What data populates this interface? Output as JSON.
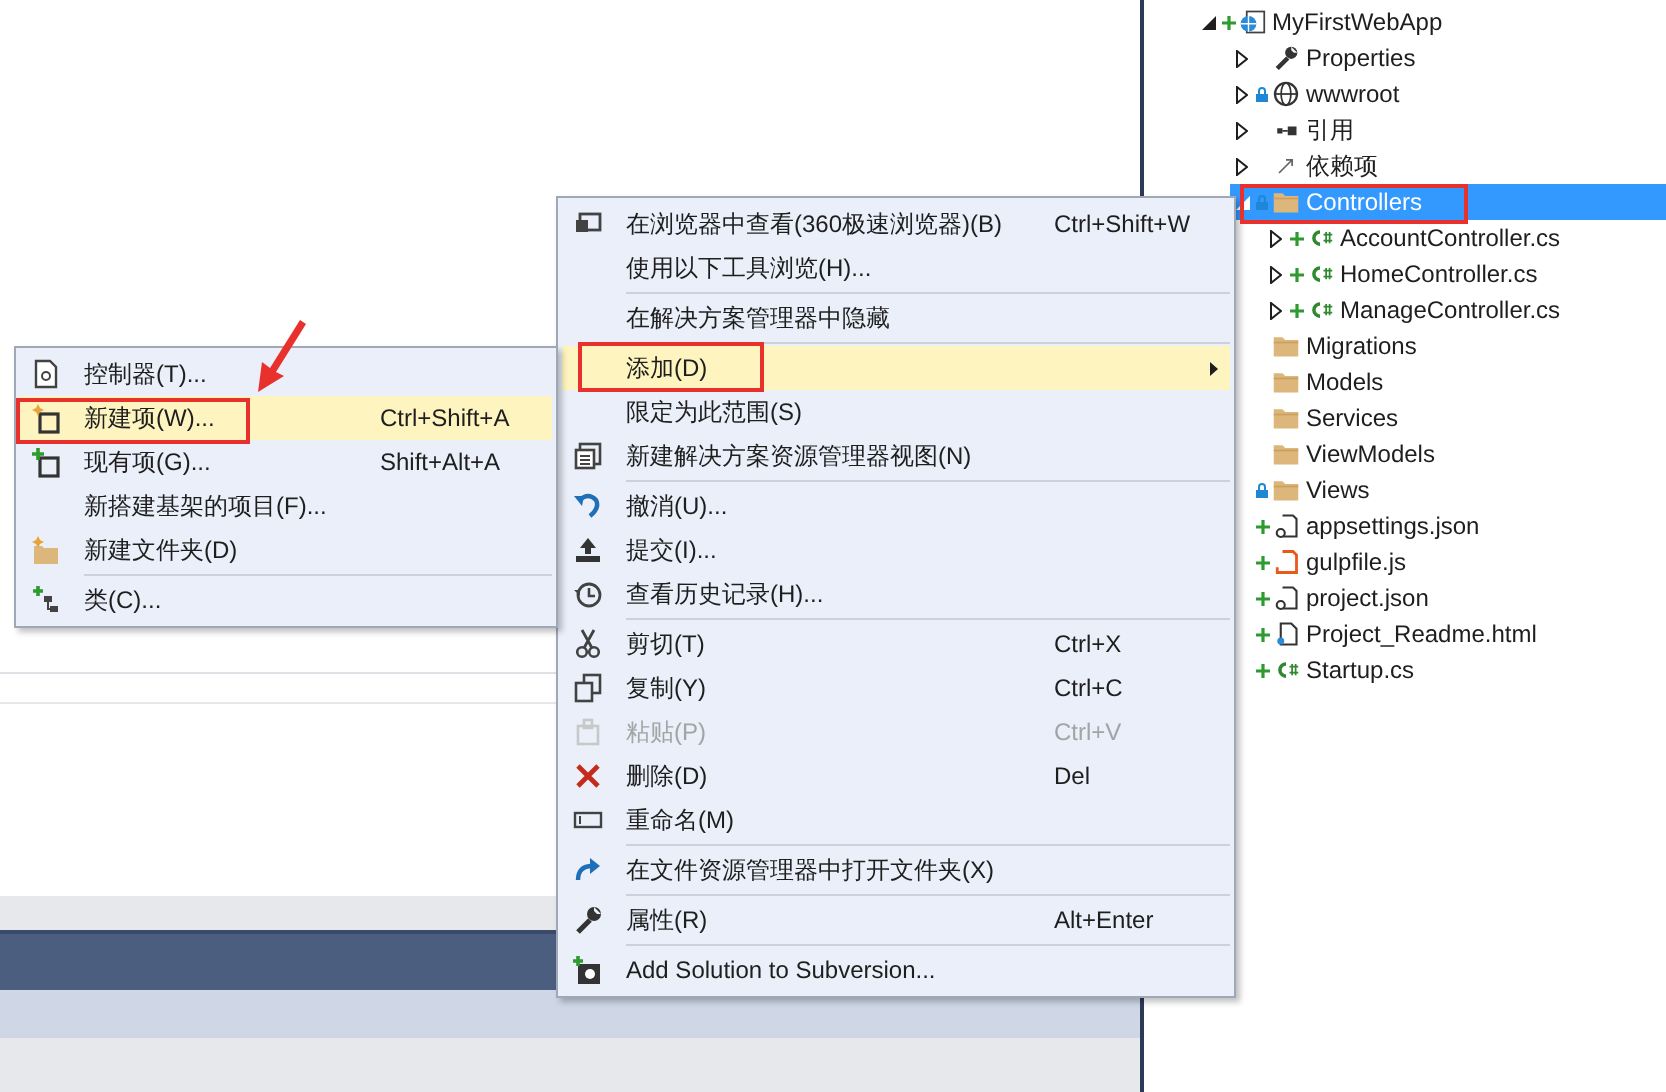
{
  "solution_explorer": {
    "tree": [
      {
        "label": "MyFirstWebApp",
        "kind": "project",
        "pending_add": true,
        "locked": false,
        "expanded": true,
        "selected": false,
        "children": [
          {
            "label": "Properties",
            "kind": "properties",
            "pending_add": false,
            "locked": false,
            "expanded": false,
            "selected": false
          },
          {
            "label": "wwwroot",
            "kind": "web",
            "pending_add": false,
            "locked": true,
            "expanded": false,
            "selected": false
          },
          {
            "label": "引用",
            "kind": "references",
            "pending_add": false,
            "locked": false,
            "expanded": false,
            "selected": false
          },
          {
            "label": "依赖项",
            "kind": "dependencies",
            "pending_add": false,
            "locked": false,
            "expanded": false,
            "selected": false
          },
          {
            "label": "Controllers",
            "kind": "folder",
            "pending_add": false,
            "locked": true,
            "expanded": true,
            "selected": true,
            "children": [
              {
                "label": "AccountController.cs",
                "kind": "csharp",
                "pending_add": true,
                "locked": false,
                "expanded": false,
                "selected": false
              },
              {
                "label": "HomeController.cs",
                "kind": "csharp",
                "pending_add": true,
                "locked": false,
                "expanded": false,
                "selected": false
              },
              {
                "label": "ManageController.cs",
                "kind": "csharp",
                "pending_add": true,
                "locked": false,
                "expanded": false,
                "selected": false
              }
            ]
          },
          {
            "label": "Migrations",
            "kind": "folder",
            "pending_add": false,
            "locked": false,
            "selected": false
          },
          {
            "label": "Models",
            "kind": "folder",
            "pending_add": false,
            "locked": false,
            "selected": false
          },
          {
            "label": "Services",
            "kind": "folder",
            "pending_add": false,
            "locked": false,
            "selected": false
          },
          {
            "label": "ViewModels",
            "kind": "folder",
            "pending_add": false,
            "locked": false,
            "selected": false
          },
          {
            "label": "Views",
            "kind": "folder",
            "pending_add": false,
            "locked": true,
            "selected": false
          },
          {
            "label": "appsettings.json",
            "kind": "json",
            "pending_add": true,
            "locked": false,
            "selected": false
          },
          {
            "label": "gulpfile.js",
            "kind": "js",
            "pending_add": true,
            "locked": false,
            "selected": false
          },
          {
            "label": "project.json",
            "kind": "json",
            "pending_add": true,
            "locked": false,
            "selected": false
          },
          {
            "label": "Project_Readme.html",
            "kind": "html",
            "pending_add": true,
            "locked": false,
            "selected": false
          },
          {
            "label": "Startup.cs",
            "kind": "csharp",
            "pending_add": true,
            "locked": false,
            "selected": false
          }
        ]
      }
    ]
  },
  "context_menu": {
    "sections": [
      [
        {
          "label": "在浏览器中查看(360极速浏览器)(B)",
          "shortcut": "Ctrl+Shift+W",
          "selected": false,
          "disabled": false
        },
        {
          "label": "使用以下工具浏览(H)...",
          "selected": false,
          "disabled": false
        }
      ],
      [
        {
          "label": "在解决方案管理器中隐藏",
          "selected": false,
          "disabled": false
        }
      ],
      [
        {
          "label": "添加(D)",
          "submenu": true,
          "selected": true,
          "disabled": false
        },
        {
          "label": "限定为此范围(S)",
          "selected": false,
          "disabled": false
        },
        {
          "label": "新建解决方案资源管理器视图(N)",
          "selected": false,
          "disabled": false
        }
      ],
      [
        {
          "label": "撤消(U)...",
          "selected": false,
          "disabled": false
        },
        {
          "label": "提交(I)...",
          "selected": false,
          "disabled": false
        },
        {
          "label": "查看历史记录(H)...",
          "selected": false,
          "disabled": false
        }
      ],
      [
        {
          "label": "剪切(T)",
          "shortcut": "Ctrl+X",
          "selected": false,
          "disabled": false
        },
        {
          "label": "复制(Y)",
          "shortcut": "Ctrl+C",
          "selected": false,
          "disabled": false
        },
        {
          "label": "粘贴(P)",
          "shortcut": "Ctrl+V",
          "selected": false,
          "disabled": true
        },
        {
          "label": "删除(D)",
          "shortcut": "Del",
          "selected": false,
          "disabled": false
        },
        {
          "label": "重命名(M)",
          "selected": false,
          "disabled": false
        }
      ],
      [
        {
          "label": "在文件资源管理器中打开文件夹(X)",
          "selected": false,
          "disabled": false
        }
      ],
      [
        {
          "label": "属性(R)",
          "shortcut": "Alt+Enter",
          "selected": false,
          "disabled": false
        }
      ],
      [
        {
          "label": "Add Solution to Subversion...",
          "selected": false,
          "disabled": false
        }
      ]
    ]
  },
  "add_submenu": {
    "sections": [
      [
        {
          "label": "控制器(T)...",
          "selected": false,
          "disabled": false
        },
        {
          "label": "新建项(W)...",
          "shortcut": "Ctrl+Shift+A",
          "selected": true,
          "disabled": false
        },
        {
          "label": "现有项(G)...",
          "shortcut": "Shift+Alt+A",
          "selected": false,
          "disabled": false
        },
        {
          "label": "新搭建基架的项目(F)...",
          "selected": false,
          "disabled": false
        },
        {
          "label": "新建文件夹(D)",
          "selected": false,
          "disabled": false
        }
      ],
      [
        {
          "label": "类(C)...",
          "selected": false,
          "disabled": false
        }
      ]
    ]
  }
}
